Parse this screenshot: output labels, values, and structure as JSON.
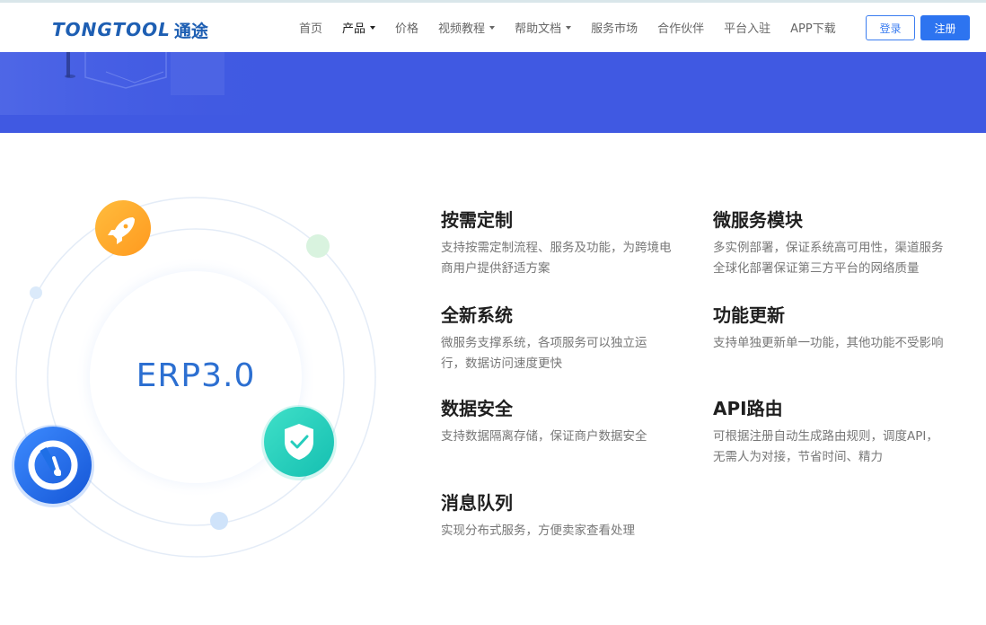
{
  "brand": {
    "logo_text": "TONGTOOL",
    "logo_cn": "通途"
  },
  "nav": {
    "items": [
      {
        "label": "首页",
        "dropdown": false,
        "active": false
      },
      {
        "label": "产品",
        "dropdown": true,
        "active": true
      },
      {
        "label": "价格",
        "dropdown": false,
        "active": false
      },
      {
        "label": "视频教程",
        "dropdown": true,
        "active": false
      },
      {
        "label": "帮助文档",
        "dropdown": true,
        "active": false
      },
      {
        "label": "服务市场",
        "dropdown": false,
        "active": false
      },
      {
        "label": "合作伙伴",
        "dropdown": false,
        "active": false
      },
      {
        "label": "平台入驻",
        "dropdown": false,
        "active": false
      },
      {
        "label": "APP下载",
        "dropdown": false,
        "active": false
      }
    ],
    "login_label": "登录",
    "register_label": "注册"
  },
  "illustration": {
    "center_text": "ERP3.0",
    "icons": [
      "rocket-icon",
      "speedometer-icon",
      "shield-check-icon"
    ]
  },
  "features": [
    {
      "title": "按需定制",
      "desc": "支持按需定制流程、服务及功能，为跨境电商用户提供舒适方案"
    },
    {
      "title": "微服务模块",
      "desc": "多实例部署，保证系统高可用性，渠道服务全球化部署保证第三方平台的网络质量"
    },
    {
      "title": "全新系统",
      "desc": "微服务支撑系统，各项服务可以独立运行，数据访问速度更快"
    },
    {
      "title": "功能更新",
      "desc": "支持单独更新单一功能，其他功能不受影响"
    },
    {
      "title": "数据安全",
      "desc": "支持数据隔离存储，保证商户数据安全"
    },
    {
      "title": "API路由",
      "desc": "可根据注册自动生成路由规则，调度API，无需人为对接，节省时间、精力"
    },
    {
      "title": "消息队列",
      "desc": "实现分布式服务，方便卖家查看处理"
    }
  ],
  "colors": {
    "brand_blue": "#1e5fb3",
    "banner": "#4059e2",
    "primary_button": "#2d74f0",
    "rocket_orange": "#ffa726",
    "shield_teal": "#26cdbd",
    "gauge_blue": "#1f6fe6"
  }
}
